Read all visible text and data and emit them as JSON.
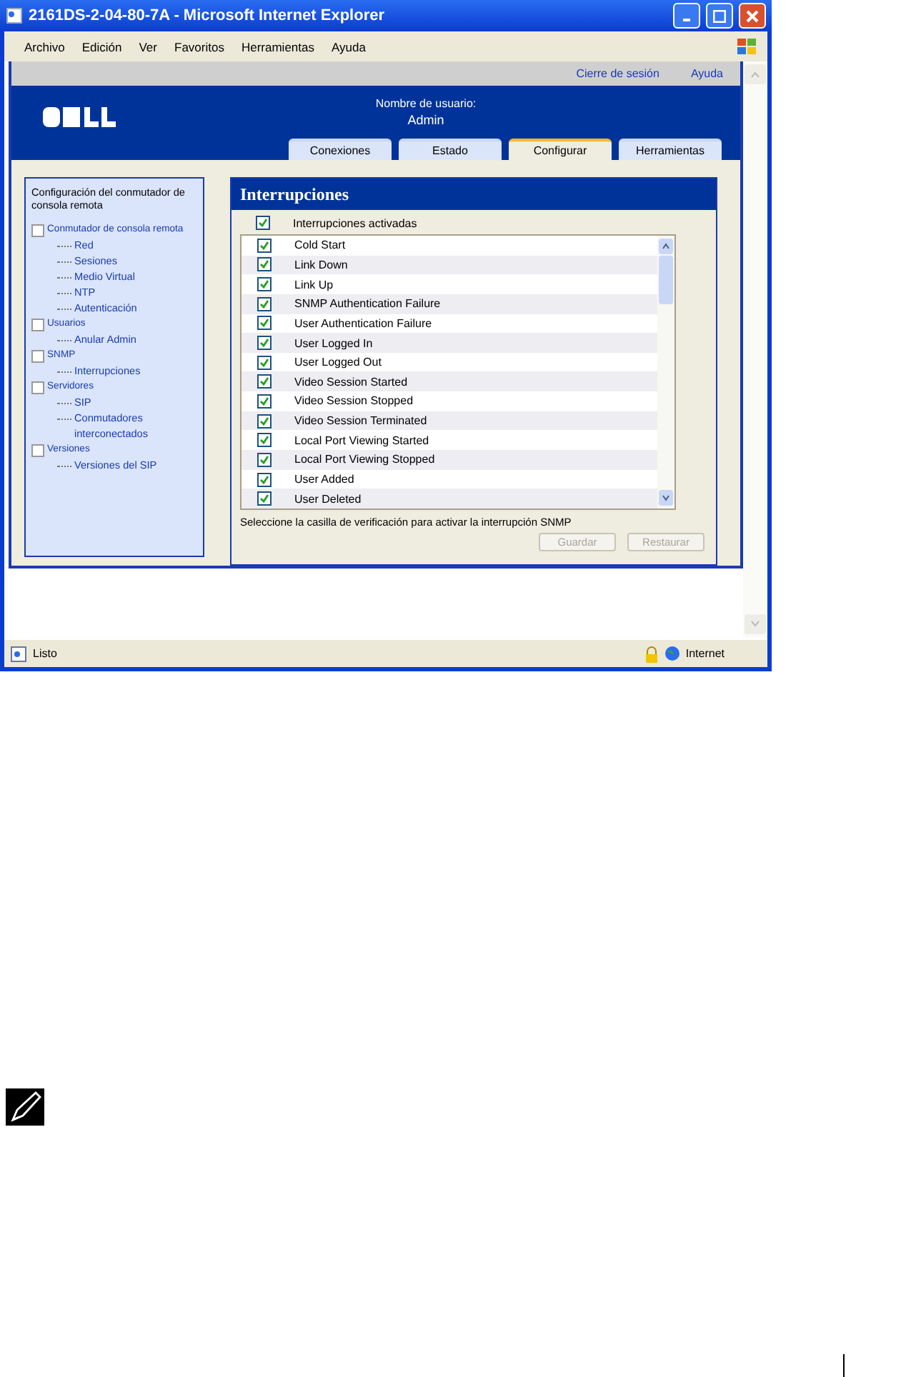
{
  "window": {
    "title": "2161DS-2-04-80-7A - Microsoft Internet Explorer"
  },
  "menu": [
    "Archivo",
    "Edición",
    "Ver",
    "Favoritos",
    "Herramientas",
    "Ayuda"
  ],
  "top_links": [
    "Cierre de sesión",
    "Ayuda"
  ],
  "user": {
    "label": "Nombre de usuario:",
    "name": "Admin"
  },
  "tabs": [
    {
      "label": "Conexiones",
      "selected": false
    },
    {
      "label": "Estado",
      "selected": false
    },
    {
      "label": "Configurar",
      "selected": true
    },
    {
      "label": "Herramientas",
      "selected": false
    }
  ],
  "sidebar": {
    "title": "Configuración del conmutador de consola remota",
    "items": [
      {
        "label": "Conmutador de consola remota",
        "children": [
          {
            "label": "Red"
          },
          {
            "label": "Sesiones"
          },
          {
            "label": "Medio Virtual"
          },
          {
            "label": "NTP"
          },
          {
            "label": "Autenticación"
          }
        ]
      },
      {
        "label": "Usuarios",
        "children": [
          {
            "label": "Anular Admin"
          }
        ]
      },
      {
        "label": "SNMP",
        "children": [
          {
            "label": "Interrupciones"
          }
        ]
      },
      {
        "label": "Servidores",
        "children": [
          {
            "label": "SIP"
          },
          {
            "label": "Conmutadores interconectados"
          }
        ]
      },
      {
        "label": "Versiones",
        "children": [
          {
            "label": "Versiones del SIP"
          }
        ]
      }
    ]
  },
  "panel": {
    "title": "Interrupciones",
    "master": {
      "label": "Interrupciones activadas",
      "checked": true
    },
    "traps": [
      {
        "label": "Cold Start",
        "checked": true
      },
      {
        "label": "Link Down",
        "checked": true
      },
      {
        "label": "Link Up",
        "checked": true
      },
      {
        "label": "SNMP Authentication Failure",
        "checked": true
      },
      {
        "label": "User Authentication Failure",
        "checked": true
      },
      {
        "label": "User Logged In",
        "checked": true
      },
      {
        "label": "User Logged Out",
        "checked": true
      },
      {
        "label": "Video Session Started",
        "checked": true
      },
      {
        "label": "Video Session Stopped",
        "checked": true
      },
      {
        "label": "Video Session Terminated",
        "checked": true
      },
      {
        "label": "Local Port Viewing Started",
        "checked": true
      },
      {
        "label": "Local Port Viewing Stopped",
        "checked": true
      },
      {
        "label": "User Added",
        "checked": true
      },
      {
        "label": "User Deleted",
        "checked": true
      }
    ],
    "hint": "Seleccione la casilla de verificación para activar la interrupción SNMP",
    "buttons": [
      {
        "label": "Guardar",
        "disabled": true
      },
      {
        "label": "Restaurar",
        "disabled": true
      }
    ]
  },
  "status_bar": {
    "text": "Listo",
    "zone": "Internet"
  }
}
